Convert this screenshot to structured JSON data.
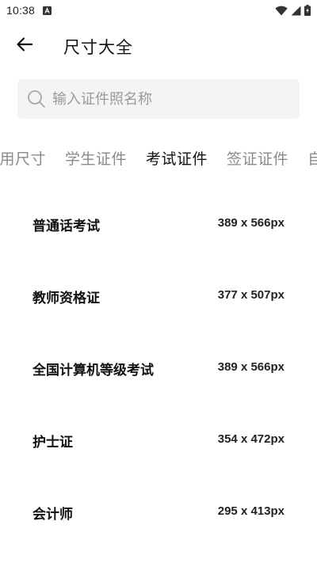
{
  "status_bar": {
    "time": "10:38"
  },
  "app_bar": {
    "title": "尺寸大全"
  },
  "search": {
    "placeholder": "输入证件照名称",
    "value": ""
  },
  "tabs": [
    {
      "label": "常用尺寸",
      "active": false
    },
    {
      "label": "学生证件",
      "active": false
    },
    {
      "label": "考试证件",
      "active": true
    },
    {
      "label": "签证证件",
      "active": false
    },
    {
      "label": "自定义",
      "active": false
    }
  ],
  "sizes": [
    {
      "name": "普通话考试",
      "dimensions": "389 x 566px"
    },
    {
      "name": "教师资格证",
      "dimensions": "377 x 507px"
    },
    {
      "name": "全国计算机等级考试",
      "dimensions": "389 x 566px"
    },
    {
      "name": "护士证",
      "dimensions": "354 x 472px"
    },
    {
      "name": "会计师",
      "dimensions": "295 x 413px"
    }
  ],
  "colors": {
    "background": "#ffffff",
    "search_bg": "#f4f4f6",
    "text_primary": "#111111",
    "text_secondary": "#8a8a8a"
  }
}
